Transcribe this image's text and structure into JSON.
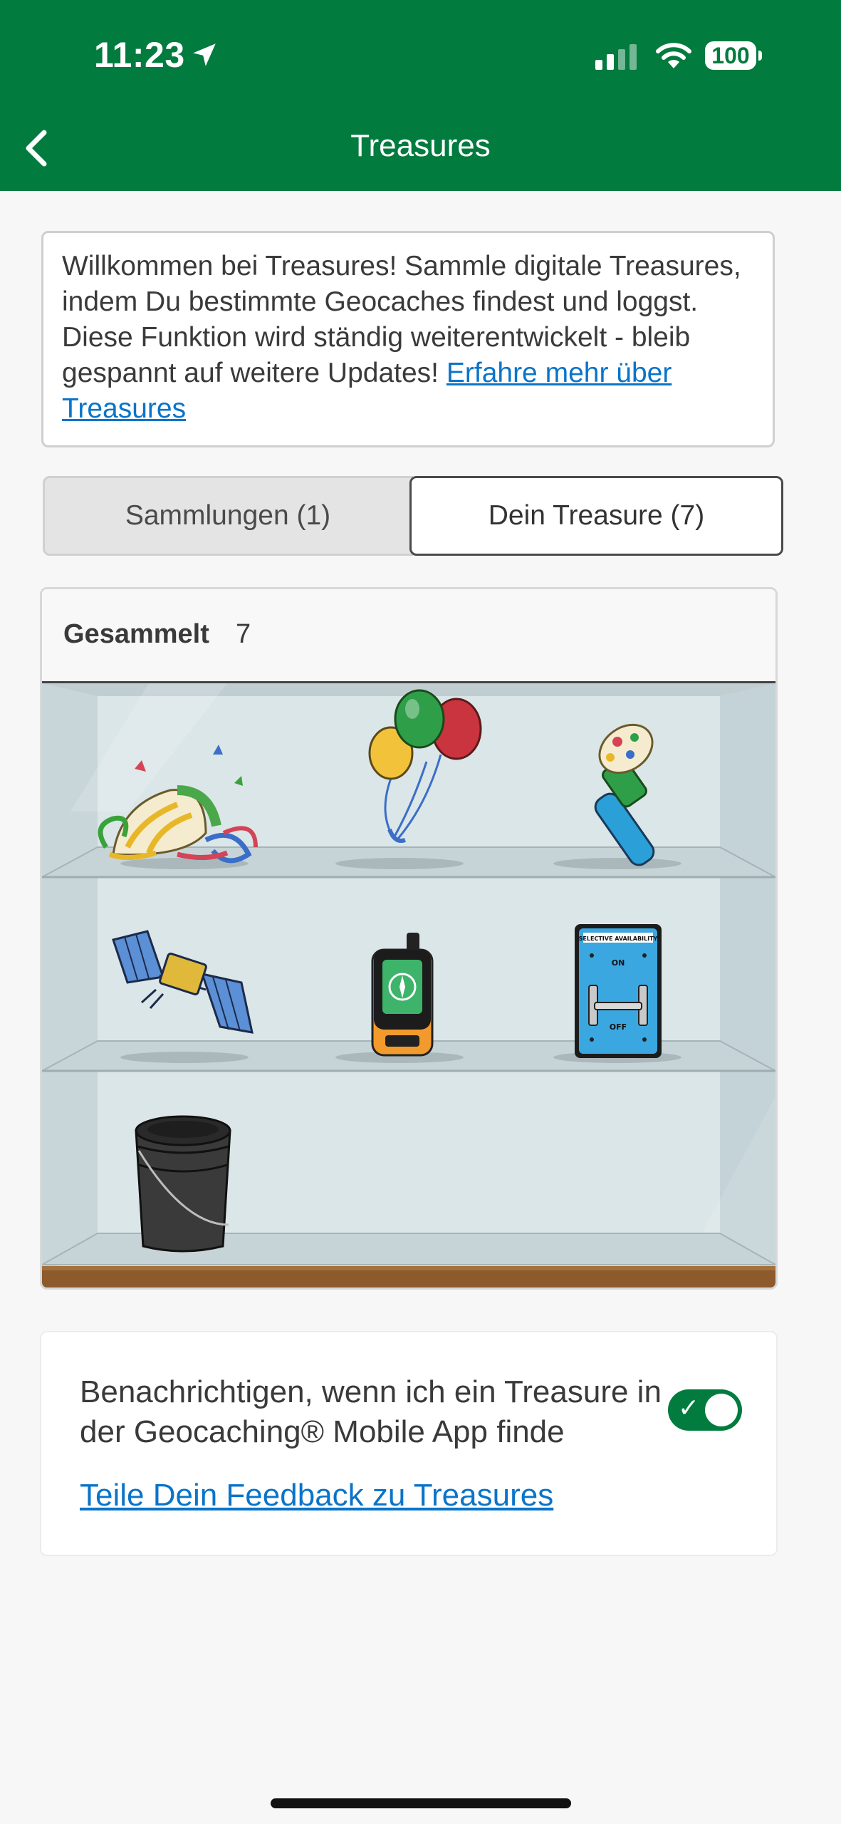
{
  "status_bar": {
    "time": "11:23",
    "battery": "100",
    "icons": [
      "location-arrow-icon",
      "signal-icon",
      "wifi-icon",
      "battery-icon"
    ]
  },
  "header": {
    "title": "Treasures",
    "back_icon": "chevron-left-icon",
    "background_color": "#027b3f"
  },
  "intro": {
    "text": "Willkommen bei Treasures! Sammle digitale Treasures, indem Du bestimmte Geocaches findest und loggst. Diese Funktion wird ständig weiterentwickelt - bleib gespannt auf weitere Updates! ",
    "link_text": "Erfahre mehr über Treasures"
  },
  "tabs": [
    {
      "label": "Sammlungen (1)",
      "selected": false
    },
    {
      "label": "Dein Treasure (7)",
      "selected": true
    }
  ],
  "collection": {
    "label": "Gesammelt",
    "count": "7",
    "items": [
      {
        "name": "party-popper",
        "shelf": 1
      },
      {
        "name": "balloons",
        "shelf": 1
      },
      {
        "name": "party-horn",
        "shelf": 1
      },
      {
        "name": "satellite",
        "shelf": 2
      },
      {
        "name": "gps-device",
        "shelf": 2
      },
      {
        "name": "selective-availability-switch",
        "shelf": 2,
        "switch_title": "SELECTIVE AVAILABILITY",
        "switch_on": "ON",
        "switch_off": "OFF"
      },
      {
        "name": "bucket",
        "shelf": 3
      }
    ]
  },
  "notify": {
    "text": "Benachrichtigen, wenn ich ein Treasure in der Geocaching® Mobile App finde",
    "toggle_on": true,
    "toggle_color": "#027b3f",
    "feedback_link": "Teile Dein Feedback zu Treasures"
  },
  "colors": {
    "accent": "#027b3f",
    "link": "#0a74c9"
  }
}
